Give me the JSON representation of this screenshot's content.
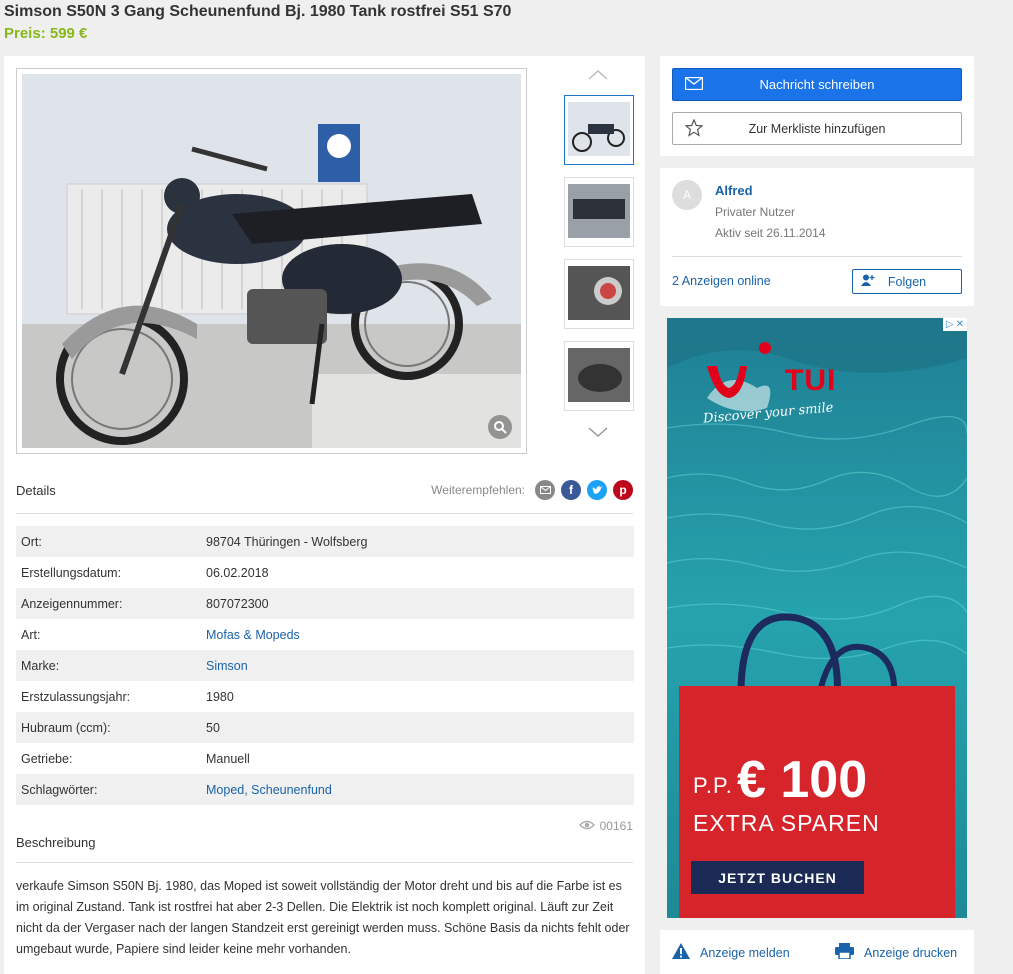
{
  "listing": {
    "title": "Simson S50N 3 Gang Scheunenfund Bj. 1980 Tank rostfrei S51 S70",
    "price": "Preis: 599 €"
  },
  "details": {
    "heading": "Details",
    "share_label": "Weiterempfehlen:",
    "share_icons": [
      "email-icon",
      "facebook-icon",
      "twitter-icon",
      "pinterest-icon"
    ],
    "rows": [
      {
        "key": "Ort:",
        "value": "98704 Thüringen - Wolfsberg"
      },
      {
        "key": "Erstellungsdatum:",
        "value": "06.02.2018"
      },
      {
        "key": "Anzeigennummer:",
        "value": "807072300"
      },
      {
        "key": "Art:",
        "value": "Mofas & Mopeds"
      },
      {
        "key": "Marke:",
        "value": "Simson"
      },
      {
        "key": "Erstzulassungsjahr:",
        "value": "1980"
      },
      {
        "key": "Hubraum (ccm):",
        "value": "50"
      },
      {
        "key": "Getriebe:",
        "value": "Manuell"
      },
      {
        "key": "Schlagwörter:",
        "value": "Moped, Scheunenfund"
      }
    ]
  },
  "views": "00161",
  "description": {
    "heading": "Beschreibung",
    "text": "verkaufe Simson S50N Bj. 1980, das Moped ist soweit vollständig der Motor dreht und bis auf die Farbe ist es im original Zustand. Tank ist rostfrei hat aber 2-3 Dellen. Die Elektrik ist noch komplett original. Läuft zur Zeit nicht da der Vergaser nach der langen Standzeit erst gereinigt werden muss. Schöne Basis da nichts fehlt oder umgebaut wurde, Papiere sind leider keine mehr vorhanden."
  },
  "actions": {
    "message_label": "Nachricht schreiben",
    "watchlist_label": "Zur Merkliste hinzufügen"
  },
  "seller": {
    "avatar_letter": "A",
    "name": "Alfred",
    "type": "Privater Nutzer",
    "since": "Aktiv seit 26.11.2014",
    "ads_online": "2 Anzeigen online",
    "follow_label": "Folgen"
  },
  "ad": {
    "brand": "TUI",
    "slogan": "Discover your smile",
    "price_prefix": "P.P.",
    "price": "€ 100",
    "extra": "EXTRA SPAREN",
    "cta": "JETZT BUCHEN"
  },
  "footer": {
    "report_label": "Anzeige melden",
    "print_label": "Anzeige drucken"
  }
}
